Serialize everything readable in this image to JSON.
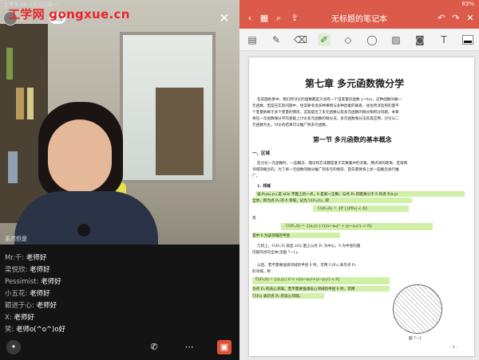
{
  "left": {
    "status_time": "上午9:48  3月2日周一",
    "watermark": "工学网  gongxue.cn",
    "host_name": "蓝",
    "follow_label": "关注",
    "viewers": "134",
    "close_glyph": "✕",
    "cam_label": "虽然但是",
    "chat": [
      {
        "user": "Mr.千:",
        "text": " 老师好"
      },
      {
        "user": "梁悦欣:",
        "text": " 老师好"
      },
      {
        "user": "Pessimist:",
        "text": " 老师好"
      },
      {
        "user": "小五花:",
        "text": " 老师好"
      },
      {
        "user": "颖进于心:",
        "text": " 老师好"
      },
      {
        "user": "X:",
        "text": " 老师好"
      },
      {
        "user": "笑:",
        "text": " 老师o(^o^)o好"
      }
    ]
  },
  "right": {
    "status": "83%",
    "note_title": "无标题的笔记本",
    "page": {
      "chapter_title": "第七章    多元函数微分学",
      "intro": [
        "在前面各章中，我们所讨论的函数都是只含有一个自变量的函数 y=f(x)，这种函数叫做一",
        "元函数。但是在实际问题中，经常要考虑多种事物与多种因素的联系，往往所涉及到的量不",
        "个变量依赖于多个变量的情形，这就提出了多元函数以及多元函数的微分和积分问题。本章",
        "将在一元函数微分学的基础上讨论多元函数的微分法，多元函数微分法及其应用。讨论以二",
        "元函数为主，讨论的结果可以推广到多元函数。"
      ],
      "section_title": "第一节    多元函数的基本概念",
      "subsection": "一、区域",
      "body": [
        "在讨论一元函数时，一些概念、理论和方法都是基于实数集中的点集、两点间的距离、区域和",
        "邻域等概念的。为了将一元函数的微分推广到多元的情形，首先需要将上述一些概念进行推",
        "广。"
      ],
      "item_1": "1. 邻域",
      "neighborhood_def": "设 P₀(x₀,y₀) 是 xOy 平面上的一点，δ 是某一正数，与点 P₀ 的距离小于 δ 的点 P(x,y)",
      "neighborhood_def2": "全体，称为点 P₀ 的 δ 邻域，记为 U(P₀,δ)，即",
      "formula_1": "U(P₀,δ) = {P | |PP₀| < δ}",
      "formula_1b": "或",
      "formula_2": "U(P₀,δ) = {(x,y) | √((x−x₀)² + (y−y₀)²) < δ}",
      "formula_2_note": "其中 δ 为该邻域的半径",
      "geom_1": "几何上，U(P₀,δ) 就是 xOy 面上以点 P₀ 为中心，δ 为半径的圆",
      "geom_2": "内部的点的全体(见图 7−1)。",
      "decenter_1": "以后，若不需要强调邻域的半径 δ 时，可用 U(P₀) 表示点 P₀",
      "decenter_2": "的邻域，称",
      "formula_3": "Ů(P₀,δ) = {(x,y) | 0 < √((x−x₀)²+(y−y₀)²) < δ}",
      "formula_3_note": "为点 P₀ 的去心邻域。若不需要强调去心邻域的半径 δ 时，可用",
      "formula_3_note2": "Ů(P₀) 表示点 P₀ 的去心邻域。",
      "figure_caption": "图 7−1",
      "page_number": "· 1 ·"
    }
  }
}
